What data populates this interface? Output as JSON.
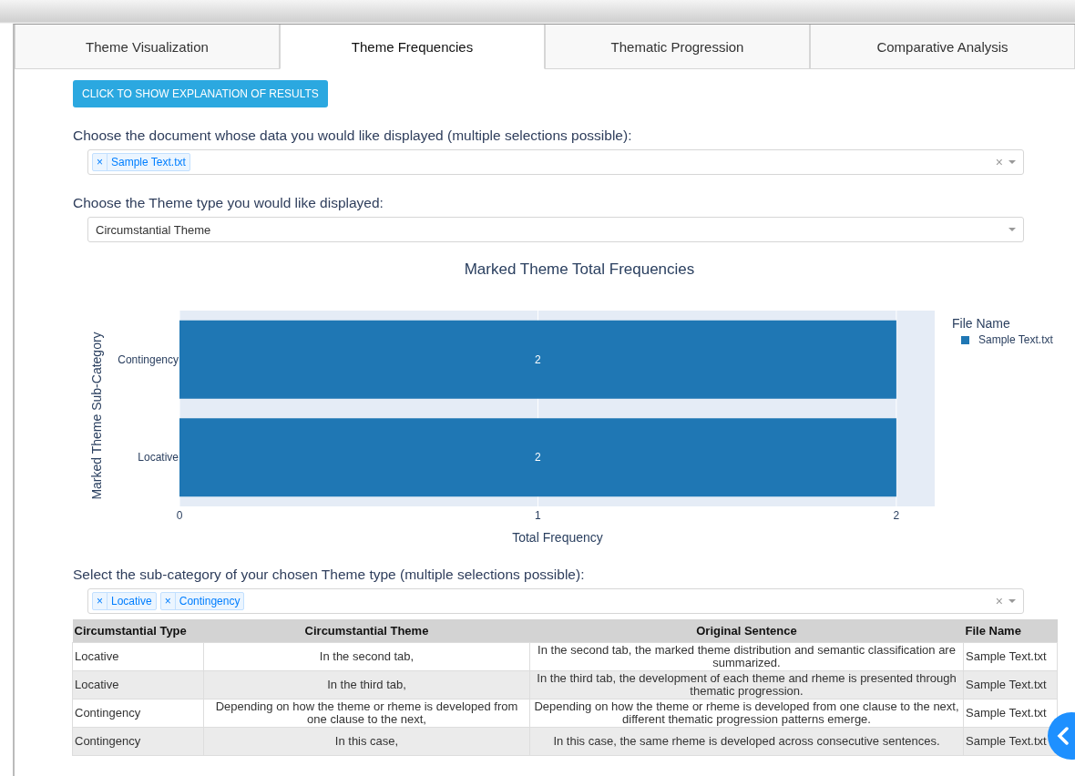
{
  "tabs": [
    {
      "label": "Theme Visualization",
      "selected": false
    },
    {
      "label": "Theme Frequencies",
      "selected": true
    },
    {
      "label": "Thematic Progression",
      "selected": false
    },
    {
      "label": "Comparative Analysis",
      "selected": false
    }
  ],
  "explain_button": "CLICK TO SHOW EXPLANATION OF RESULTS",
  "document_select": {
    "label": "Choose the document whose data you would like displayed (multiple selections possible):",
    "chips": [
      {
        "remove": "×",
        "label": "Sample Text.txt"
      }
    ],
    "clear": "×"
  },
  "theme_type_select": {
    "label": "Choose the Theme type you would like displayed:",
    "value": "Circumstantial Theme"
  },
  "chart": {
    "chart_data": {
      "type": "bar",
      "orientation": "h",
      "title": "Marked Theme Total Frequencies",
      "xlabel": "Total Frequency",
      "ylabel": "Marked Theme Sub-Category",
      "categories": [
        "Contingency",
        "Locative"
      ],
      "series": [
        {
          "name": "Sample Text.txt",
          "color": "#1f77b4",
          "values": [
            2,
            2
          ]
        }
      ],
      "xlim": [
        0,
        2.107
      ],
      "xticks": [
        0,
        1,
        2
      ],
      "data_labels": true
    },
    "legend_title": "File Name"
  },
  "subcategory_select": {
    "label": "Select the sub-category of your chosen Theme type (multiple selections possible):",
    "chips": [
      {
        "remove": "×",
        "label": "Locative"
      },
      {
        "remove": "×",
        "label": "Contingency"
      }
    ],
    "clear": "×"
  },
  "table": {
    "columns": [
      "Circumstantial Type",
      "Circumstantial Theme",
      "Original Sentence",
      "File Name"
    ],
    "rows": [
      [
        "Locative",
        "In the second tab,",
        "In the second tab, the marked theme distribution and semantic classification are summarized.",
        "Sample Text.txt"
      ],
      [
        "Locative",
        "In the third tab,",
        "In the third tab, the development of each theme and rheme is presented through thematic progression.",
        "Sample Text.txt"
      ],
      [
        "Contingency",
        "Depending on how the theme or rheme is developed from one clause to the next,",
        "Depending on how the theme or rheme is developed from one clause to the next, different thematic progression patterns emerge.",
        "Sample Text.txt"
      ],
      [
        "Contingency",
        "In this case,",
        "In this case, the same rheme is developed across consecutive sentences.",
        "Sample Text.txt"
      ]
    ]
  }
}
